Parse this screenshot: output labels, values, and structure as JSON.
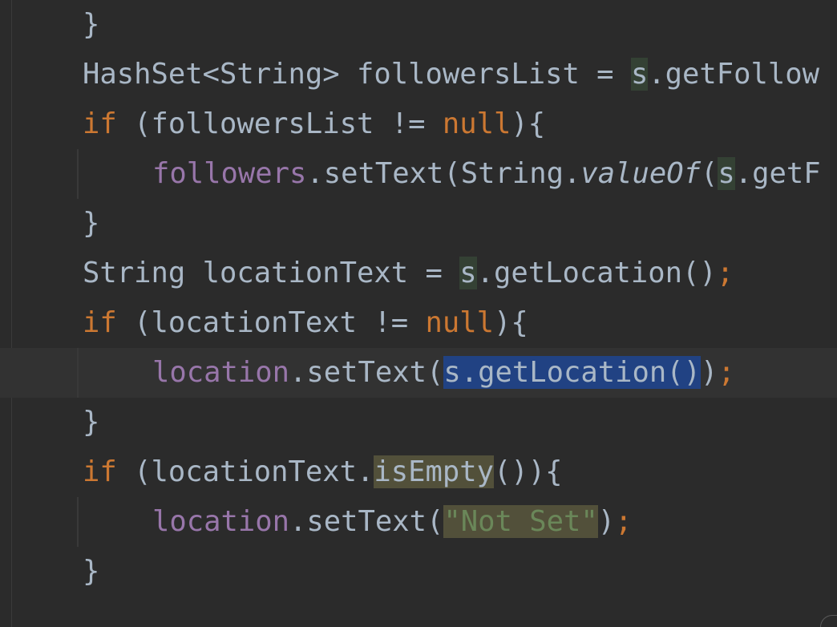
{
  "editor": {
    "lines": [
      {
        "parts": [
          {
            "t": "}",
            "c": ""
          }
        ]
      },
      {
        "parts": [
          {
            "t": "HashSet<String> followersList = ",
            "c": ""
          },
          {
            "t": "s",
            "c": "var-hl"
          },
          {
            "t": ".getFollow",
            "c": ""
          }
        ]
      },
      {
        "parts": [
          {
            "t": "if",
            "c": "kw"
          },
          {
            "t": " (followersList != ",
            "c": ""
          },
          {
            "t": "null",
            "c": "kw"
          },
          {
            "t": "){",
            "c": ""
          }
        ]
      },
      {
        "parts": [
          {
            "t": "followers",
            "c": "field"
          },
          {
            "t": ".setText(String.",
            "c": ""
          },
          {
            "t": "valueOf",
            "c": "italic"
          },
          {
            "t": "(",
            "c": ""
          },
          {
            "t": "s",
            "c": "var-hl"
          },
          {
            "t": ".getF",
            "c": ""
          }
        ]
      },
      {
        "parts": [
          {
            "t": "}",
            "c": ""
          }
        ]
      },
      {
        "parts": [
          {
            "t": "String locationText = ",
            "c": ""
          },
          {
            "t": "s",
            "c": "var-hl"
          },
          {
            "t": ".getLocation()",
            "c": ""
          },
          {
            "t": ";",
            "c": "kw"
          }
        ]
      },
      {
        "parts": [
          {
            "t": "if",
            "c": "kw"
          },
          {
            "t": " (locationText != ",
            "c": ""
          },
          {
            "t": "null",
            "c": "kw"
          },
          {
            "t": "){",
            "c": ""
          }
        ]
      },
      {
        "parts": [
          {
            "t": "location",
            "c": "field"
          },
          {
            "t": ".setText(",
            "c": ""
          },
          {
            "t": "s.getLocation()",
            "c": "sel"
          },
          {
            "t": ")",
            "c": ""
          },
          {
            "t": ";",
            "c": "kw"
          }
        ]
      },
      {
        "parts": [
          {
            "t": "}",
            "c": ""
          }
        ]
      },
      {
        "parts": [
          {
            "t": "if",
            "c": "kw"
          },
          {
            "t": " (locationText.",
            "c": ""
          },
          {
            "t": "isEmpty",
            "c": "usage-hl"
          },
          {
            "t": "()){",
            "c": ""
          }
        ]
      },
      {
        "parts": [
          {
            "t": "location",
            "c": "field"
          },
          {
            "t": ".setText(",
            "c": ""
          },
          {
            "t": "\"Not Set\"",
            "c": "str usage-hl"
          },
          {
            "t": ")",
            "c": ""
          },
          {
            "t": ";",
            "c": "kw"
          }
        ]
      },
      {
        "parts": [
          {
            "t": "}",
            "c": ""
          }
        ]
      }
    ]
  }
}
